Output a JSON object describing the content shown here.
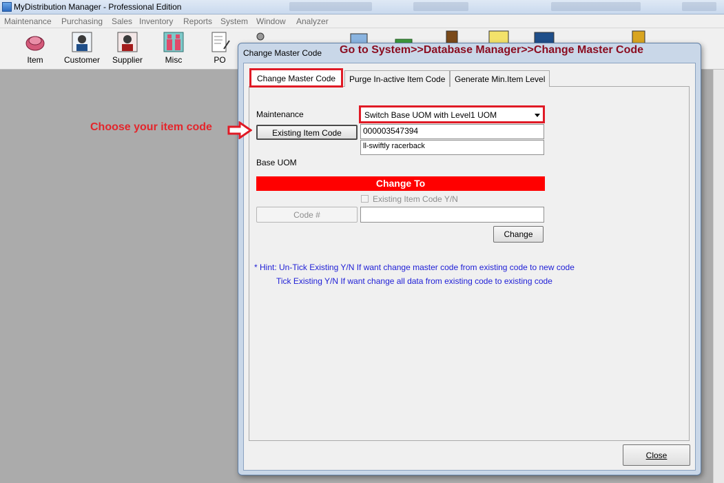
{
  "app": {
    "title": "MyDistribution Manager - Professional Edition"
  },
  "menu": [
    "Maintenance",
    "Purchasing",
    "Sales",
    "Inventory",
    "Reports",
    "System",
    "Window",
    "Analyzer"
  ],
  "toolbar": {
    "items": [
      {
        "label": "Item",
        "icon": "item-icon"
      },
      {
        "label": "Customer",
        "icon": "customer-icon"
      },
      {
        "label": "Supplier",
        "icon": "supplier-icon"
      },
      {
        "label": "Misc",
        "icon": "misc-icon"
      },
      {
        "label": "PO",
        "icon": "po-icon"
      }
    ]
  },
  "dialog": {
    "title": "Change Master Code",
    "tabs": [
      "Change Master Code",
      "Purge In-active Item Code",
      "Generate Min.Item Level"
    ],
    "maintenance_label": "Maintenance",
    "maintenance_value": "Switch Base UOM with Level1 UOM",
    "existing_item_button": "Existing Item Code",
    "item_code_value": "000003547394",
    "item_desc_value": "ll-swiftly racerback",
    "base_uom_label": "Base UOM",
    "change_to_banner": "Change To",
    "existing_checkbox_label": "Existing Item Code Y/N",
    "code_button": "Code #",
    "new_code_value": "",
    "change_button": "Change",
    "hint_line1": "* Hint: Un-Tick Existing Y/N If want change master code from existing code to new code",
    "hint_line2": "Tick Existing Y/N If want change all data from existing code to existing code",
    "close_button": "Close"
  },
  "annotations": {
    "instruction": "Go to System>>Database Manager>>Change Master Code",
    "choose_item": "Choose your item code",
    "highlight_color": "#e01a25",
    "instruction_color": "#8b0d20"
  }
}
